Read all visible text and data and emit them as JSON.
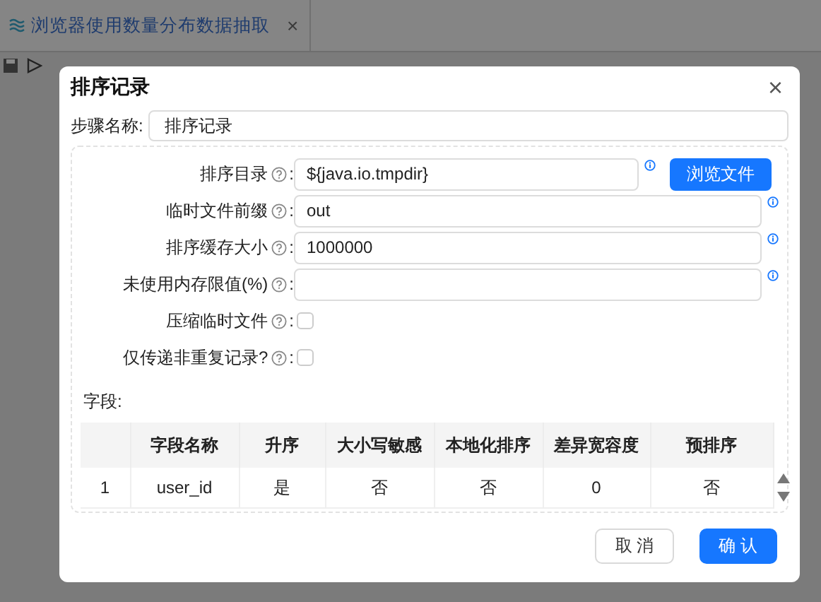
{
  "tab": {
    "title": "浏览器使用数量分布数据抽取",
    "close": "×"
  },
  "dialog": {
    "title": "排序记录",
    "close": "×"
  },
  "step_name": {
    "label": "步骤名称:",
    "value": "排序记录"
  },
  "fields": [
    {
      "kind": "text",
      "label": "排序目录",
      "colon": ":",
      "value": "${java.io.tmpdir}",
      "button": "浏览文件"
    },
    {
      "kind": "text",
      "label": "临时文件前缀",
      "colon": ":",
      "value": "out"
    },
    {
      "kind": "text",
      "label": "排序缓存大小",
      "colon": ":",
      "value": "1000000"
    },
    {
      "kind": "text",
      "label": "未使用内存限值(%)",
      "colon": ":"
    },
    {
      "kind": "checkbox",
      "label": "压缩临时文件",
      "colon": ":",
      "checked": false
    },
    {
      "kind": "checkbox",
      "label": "仅传递非重复记录?",
      "colon": ":",
      "checked": false
    }
  ],
  "fields_label": "字段:",
  "table": {
    "columns": [
      "字段名称",
      "升序",
      "大小写敏感",
      "本地化排序",
      "差异宽容度",
      "预排序"
    ],
    "rows": [
      {
        "index": "1",
        "cells": [
          "user_id",
          "是",
          "否",
          "否",
          "0",
          "否"
        ]
      }
    ]
  },
  "buttons": [
    {
      "label": "取 消",
      "kind": "default"
    },
    {
      "label": "确 认",
      "kind": "primary"
    }
  ]
}
